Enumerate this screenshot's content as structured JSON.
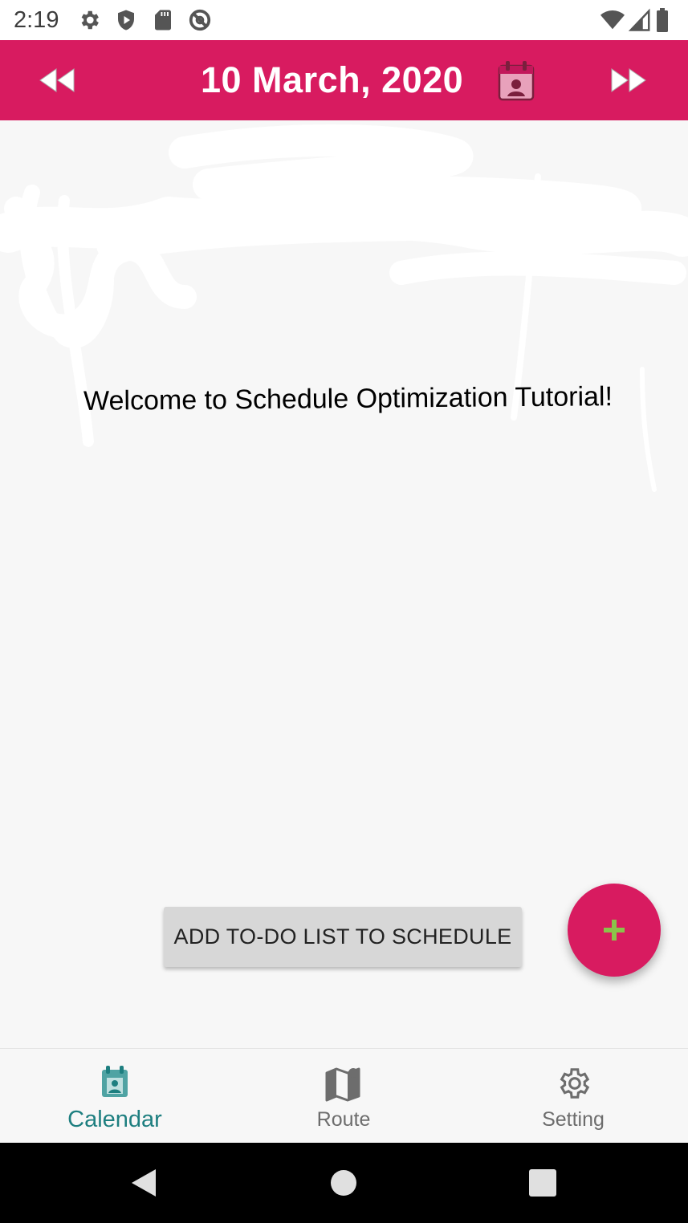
{
  "status_bar": {
    "time": "2:19",
    "icons": [
      "gear-icon",
      "shield-icon",
      "sd-card-icon",
      "at-sign-icon",
      "wifi-icon",
      "cell-signal-icon",
      "battery-icon"
    ]
  },
  "header": {
    "date": "10 March, 2020",
    "prev_icon": "rewind-icon",
    "next_icon": "fast-forward-icon",
    "calendar_icon": "calendar-icon",
    "color": "#d81b60"
  },
  "main": {
    "welcome_text": "Welcome to Schedule Optimization Tutorial!",
    "add_todo_button": "ADD TO-DO LIST TO SCHEDULE",
    "fab_icon": "plus-icon",
    "fab_color": "#d81b60",
    "fab_plus_color": "#8bc34a"
  },
  "bottom_nav": {
    "items": [
      {
        "label": "Calendar",
        "icon": "calendar-icon",
        "active": true
      },
      {
        "label": "Route",
        "icon": "map-icon",
        "active": false
      },
      {
        "label": "Setting",
        "icon": "gear-icon",
        "active": false
      }
    ],
    "active_color": "#1e7f80",
    "inactive_color": "#6d6d6d"
  },
  "system_nav": {
    "icons": [
      "back-icon",
      "home-icon",
      "recents-icon"
    ]
  }
}
